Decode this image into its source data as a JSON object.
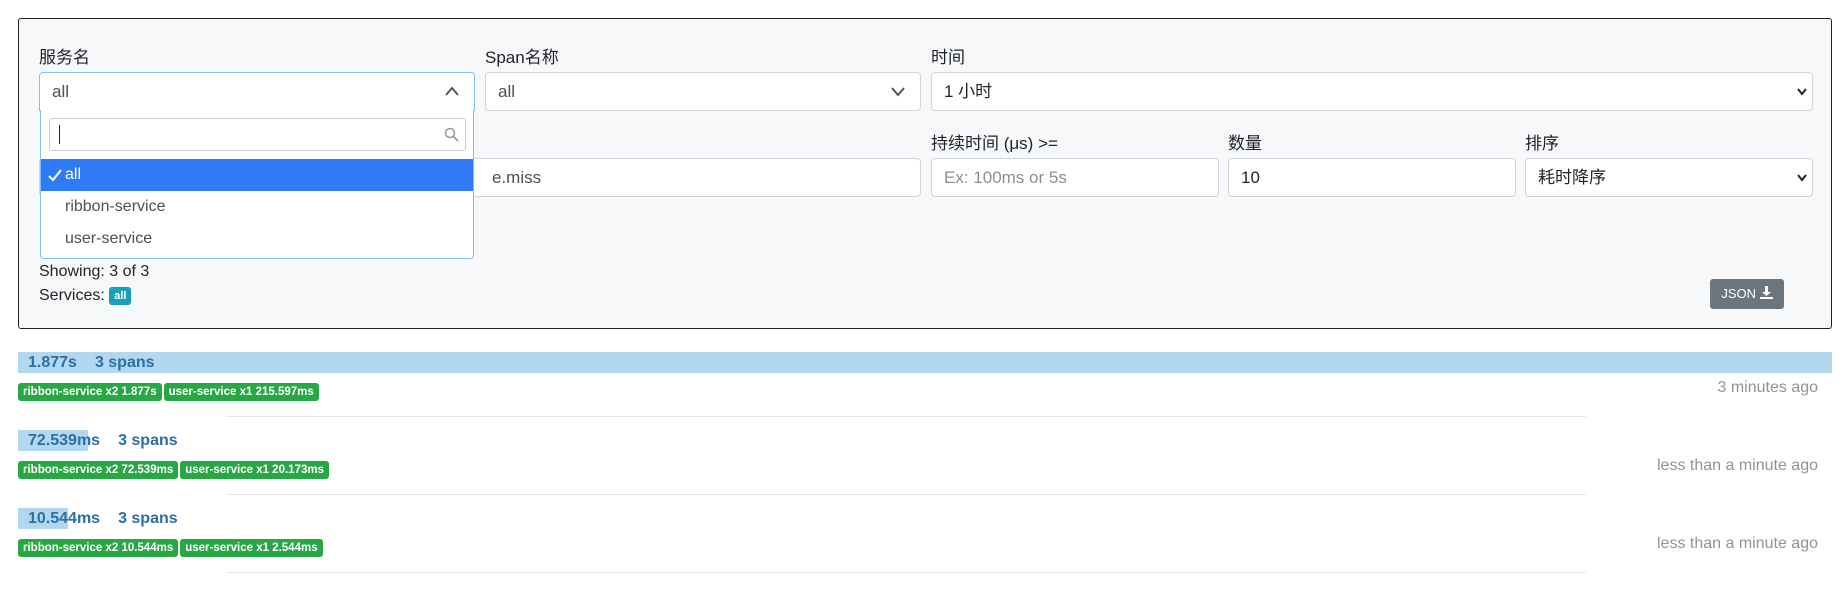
{
  "filters": {
    "service": {
      "label": "服务名",
      "value": "all"
    },
    "span": {
      "label": "Span名称",
      "value": "all"
    },
    "time": {
      "label": "时间",
      "value": "1 小时"
    },
    "annotation": {
      "value_fragment": "e.miss"
    },
    "duration": {
      "label": "持续时间 (μs) >=",
      "placeholder": "Ex: 100ms or 5s"
    },
    "count": {
      "label": "数量",
      "value": "10"
    },
    "sort": {
      "label": "排序",
      "value": "耗时降序"
    }
  },
  "service_dropdown": {
    "search_value": "",
    "options": [
      "all",
      "ribbon-service",
      "user-service"
    ],
    "selected": "all"
  },
  "results": {
    "showing": "Showing: 3 of 3",
    "services_label": "Services:",
    "services_badge": "all",
    "json_button": "JSON"
  },
  "traces": [
    {
      "duration": "1.877s",
      "spans": "3 spans",
      "bar_fraction": 1.0,
      "services": [
        "ribbon-service x2 1.877s",
        "user-service x1 215.597ms"
      ],
      "ago": "3 minutes ago"
    },
    {
      "duration": "72.539ms",
      "spans": "3 spans",
      "bar_fraction": 0.0386,
      "services": [
        "ribbon-service x2 72.539ms",
        "user-service x1 20.173ms"
      ],
      "ago": "less than a minute ago"
    },
    {
      "duration": "10.544ms",
      "spans": "3 spans",
      "bar_fraction": 0.0056,
      "services": [
        "ribbon-service x2 10.544ms",
        "user-service x1 2.544ms"
      ],
      "ago": "less than a minute ago"
    }
  ],
  "colors": {
    "accent": "#2f7bf6",
    "duration_bar": "#b3d7ef",
    "service_badge": "#28a745",
    "info_badge": "#17a2b8"
  },
  "icons": [
    "chevron-up-icon",
    "chevron-down-icon",
    "search-icon",
    "check-icon",
    "download-icon"
  ]
}
